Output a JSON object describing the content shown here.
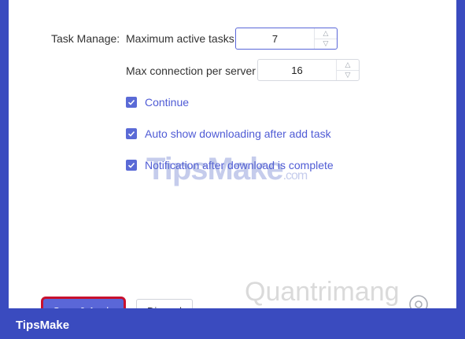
{
  "settings": {
    "section_label": "Task Manage:",
    "max_active_tasks": {
      "label": "Maximum active tasks",
      "value": "7"
    },
    "max_connection": {
      "label": "Max connection per server",
      "value": "16"
    },
    "options": [
      {
        "label": "Continue",
        "checked": true
      },
      {
        "label": "Auto show downloading after add task",
        "checked": true
      },
      {
        "label": "Notification after download is complete",
        "checked": true
      }
    ]
  },
  "buttons": {
    "save_label": "Save & Apply",
    "discard_label": "Discard"
  },
  "watermarks": {
    "tipsmake": "TipsMake",
    "tipsmake_suffix": ".com",
    "quantrimang": "Quantrimang"
  },
  "footer": {
    "brand": "TipsMake"
  },
  "colors": {
    "accent": "#5a67d8",
    "frame": "#3a4bbf",
    "highlight": "#c8102e"
  }
}
